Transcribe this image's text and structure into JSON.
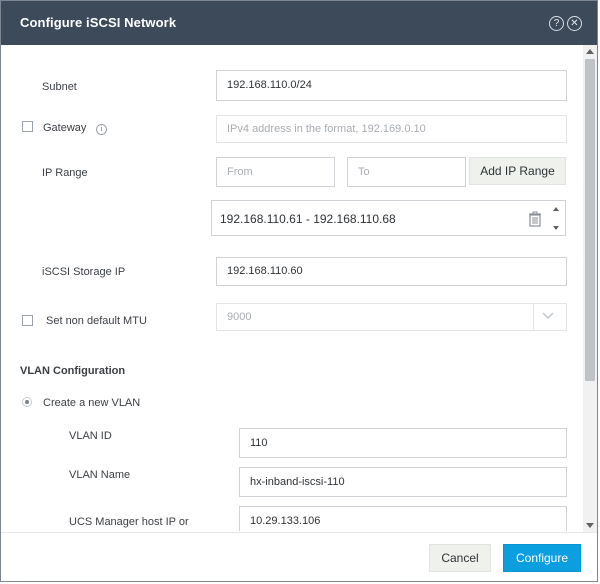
{
  "dialog": {
    "title": "Configure iSCSI Network",
    "help_icon": "help-circle-icon",
    "close_icon": "close-circle-icon"
  },
  "form": {
    "subnet": {
      "label": "Subnet",
      "value": "192.168.110.0/24"
    },
    "gateway": {
      "label": "Gateway",
      "checked": false,
      "placeholder": "IPv4 address in the format, 192.169.0.10",
      "info_icon": "info-icon"
    },
    "ip_range": {
      "label": "IP Range",
      "from_placeholder": "From",
      "to_placeholder": "To",
      "add_button": "Add IP Range",
      "entries": [
        "192.168.110.61 - 192.168.110.68"
      ]
    },
    "iscsi_storage_ip": {
      "label": "iSCSI Storage IP",
      "value": "192.168.110.60"
    },
    "mtu": {
      "label": "Set non default MTU",
      "checked": false,
      "value": "9000"
    },
    "vlan": {
      "section_title": "VLAN Configuration",
      "create_option": "Create a new VLAN",
      "vlan_id": {
        "label": "VLAN ID",
        "value": "110"
      },
      "vlan_name": {
        "label": "VLAN Name",
        "value": "hx-inband-iscsi-110"
      },
      "ucs_host": {
        "label": "UCS Manager host IP or",
        "value": "10.29.133.106"
      }
    }
  },
  "footer": {
    "cancel": "Cancel",
    "configure": "Configure"
  },
  "colors": {
    "titlebar": "#3c4a5a",
    "primary_button": "#0b9fe0",
    "secondary_button": "#eef1ec"
  }
}
